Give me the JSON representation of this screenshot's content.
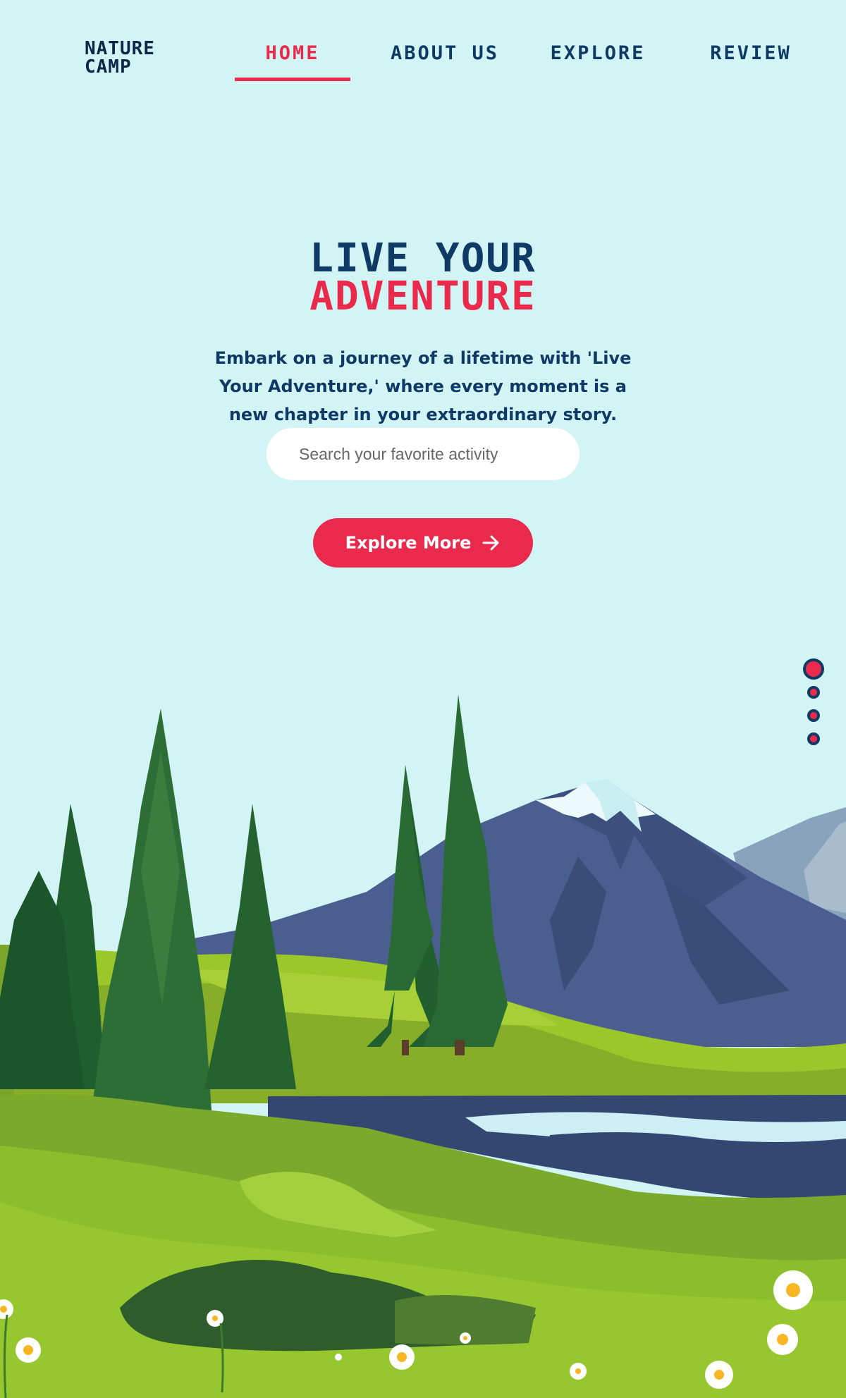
{
  "header": {
    "logo": "Nature Camp",
    "nav": [
      {
        "label": "Home",
        "active": true
      },
      {
        "label": "About Us",
        "active": false
      },
      {
        "label": "Explore",
        "active": false
      },
      {
        "label": "Review",
        "active": false
      }
    ]
  },
  "hero": {
    "title_line1": "Live Your",
    "title_line2": "Adventure",
    "description": "Embark on a journey of a lifetime with 'Live Your Adventure,' where every moment is a new chapter in your extraordinary story.",
    "search_placeholder": "Search your favorite activity",
    "cta_label": "Explore More",
    "cta_icon": "arrow-right-icon"
  },
  "slider": {
    "slide_count": 4,
    "active_index": 0
  },
  "colors": {
    "background": "#d2f4f4",
    "primary": "#0f3a66",
    "accent": "#ea2a4d"
  }
}
